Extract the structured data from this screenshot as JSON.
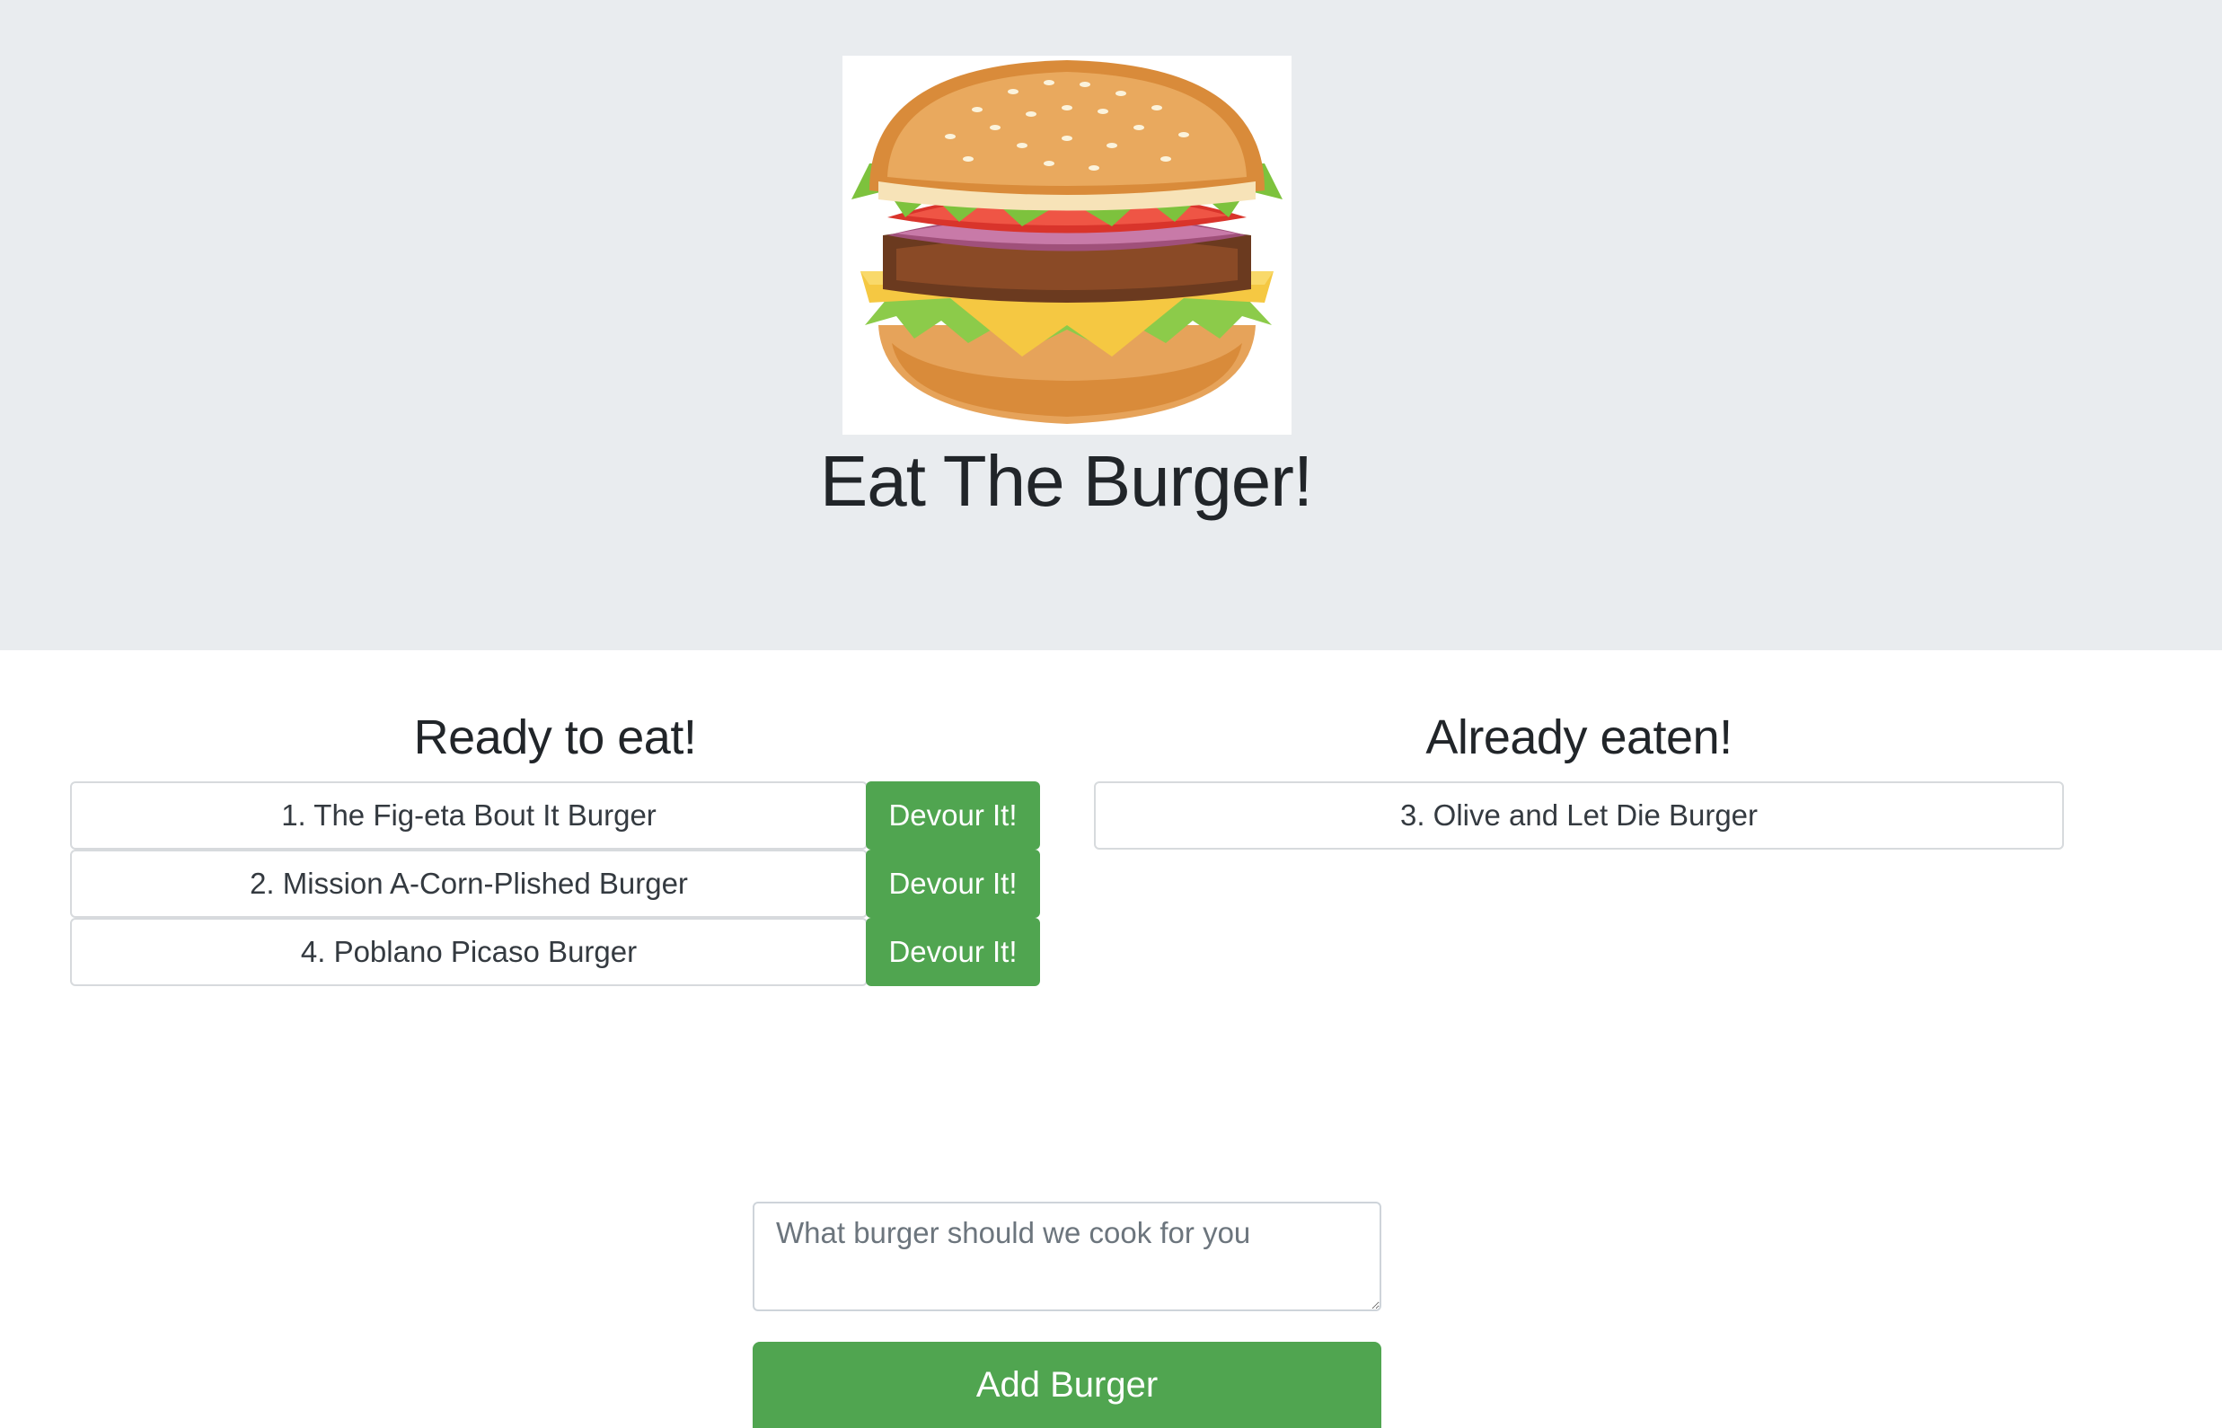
{
  "header": {
    "title": "Eat The Burger!",
    "image_name": "burger-image"
  },
  "ready": {
    "title": "Ready to eat!",
    "items": [
      {
        "label": "1. The Fig-eta Bout It Burger",
        "button": "Devour It!"
      },
      {
        "label": "2. Mission A-Corn-Plished Burger",
        "button": "Devour It!"
      },
      {
        "label": "4. Poblano Picaso Burger",
        "button": "Devour It!"
      }
    ]
  },
  "eaten": {
    "title": "Already eaten!",
    "items": [
      {
        "label": "3. Olive and Let Die Burger"
      }
    ]
  },
  "form": {
    "placeholder": "What burger should we cook for you",
    "value": "",
    "submit_label": "Add Burger"
  },
  "colors": {
    "header_bg": "#e9ecef",
    "button_green": "#50a550"
  }
}
